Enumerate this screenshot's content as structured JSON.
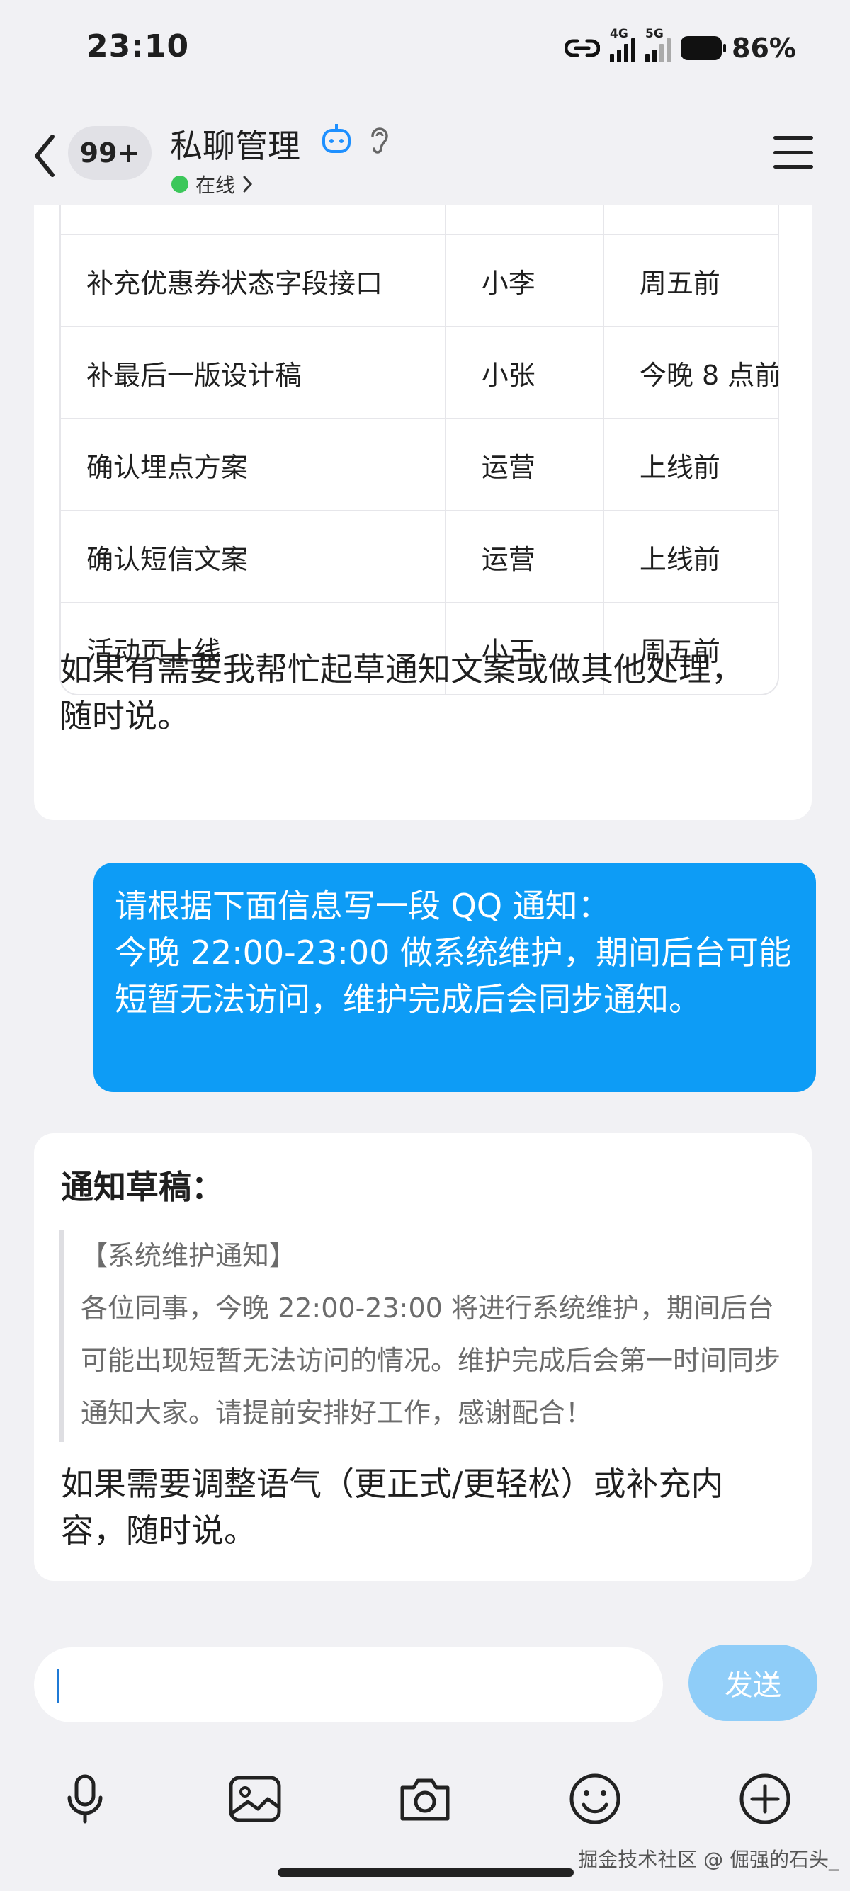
{
  "status_bar": {
    "time": "23:10",
    "net1": "4G",
    "net2": "5G",
    "battery": "86%"
  },
  "header": {
    "unread": "99+",
    "title": "私聊管理",
    "status": "在线",
    "status_color": "#3cc75a"
  },
  "messages": {
    "table_rows": [
      {
        "task": "补充优惠券状态字段接口",
        "owner": "小李",
        "deadline": "周五前"
      },
      {
        "task": "补最后一版设计稿",
        "owner": "小张",
        "deadline": "今晚 8 点前"
      },
      {
        "task": "确认埋点方案",
        "owner": "运营",
        "deadline": "上线前"
      },
      {
        "task": "确认短信文案",
        "owner": "运营",
        "deadline": "上线前"
      },
      {
        "task": "活动页上线",
        "owner": "小王",
        "deadline": "周五前"
      }
    ],
    "bot_followup": "如果有需要我帮忙起草通知文案或做其他处理，随时说。",
    "user_message": "请根据下面信息写一段 QQ 通知：\n今晚 22:00-23:00 做系统维护，期间后台可能短暂无法访问，维护完成后会同步通知。",
    "draft_heading": "通知草稿：",
    "draft_title": "【系统维护通知】",
    "draft_body": "各位同事，今晚 22:00-23:00 将进行系统维护，期间后台可能出现短暂无法访问的情况。维护完成后会第一时间同步通知大家。请提前安排好工作，感谢配合！",
    "draft_tail": "如果需要调整语气（更正式/更轻松）或补充内容，随时说。"
  },
  "composer": {
    "input_value": "",
    "send_label": "发送"
  },
  "toolbar": {
    "icons": [
      "microphone-icon",
      "image-icon",
      "camera-icon",
      "emoji-icon",
      "plus-icon"
    ]
  },
  "watermark": "掘金技术社区 @ 倔强的石头_",
  "colors": {
    "user_bubble": "#0d9cf6",
    "send_disabled": "#8fcdf8",
    "background": "#f1f1f4"
  }
}
